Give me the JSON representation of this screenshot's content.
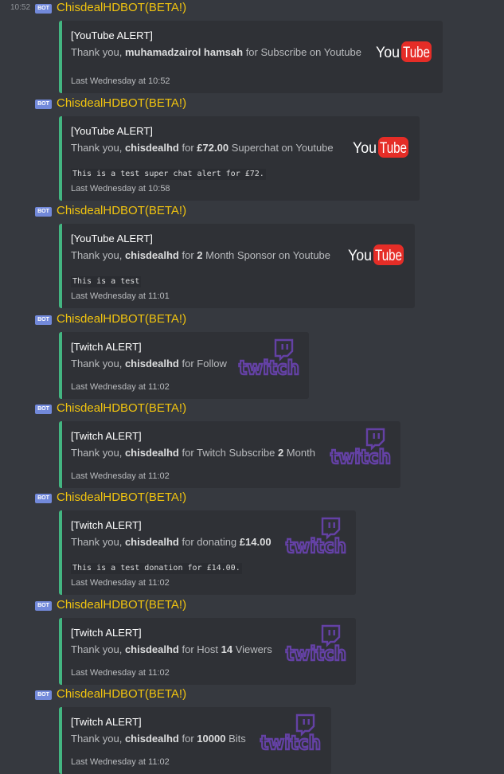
{
  "channel": {
    "first_timestamp": "10:52",
    "bot_tag": "BOT",
    "author": "ChisdealHDBOT(BETA!)"
  },
  "colors": {
    "background": "#36393f",
    "embed_background": "#2f3136",
    "embed_border": "#43b581",
    "author": "#f1c40f",
    "bot_tag": "#7289da",
    "youtube_red": "#e52d27",
    "twitch_purple": "#6441a5"
  },
  "messages": [
    {
      "title": "[YouTube ALERT]",
      "thank": "Thank you,",
      "user": "muhamadzairol hamsah",
      "pre": "for",
      "amount": "",
      "rest": "Subscribe on Youtube",
      "code": "",
      "footer": "Last Wednesday at 10:52",
      "logo": "youtube-logo",
      "logo_you": "You",
      "logo_tube": "Tube"
    },
    {
      "title": "[YouTube ALERT]",
      "thank": "Thank you,",
      "user": "chisdealhd",
      "pre": "for",
      "amount": "£72.00",
      "rest": "Superchat on Youtube",
      "code": "This is a test super chat alert for £72.",
      "footer": "Last Wednesday at 10:58",
      "logo": "youtube-logo",
      "logo_you": "You",
      "logo_tube": "Tube"
    },
    {
      "title": "[YouTube ALERT]",
      "thank": "Thank you,",
      "user": "chisdealhd",
      "pre": "for",
      "amount": "2",
      "rest": "Month Sponsor on Youtube",
      "code": "This is a test",
      "footer": "Last Wednesday at 11:01",
      "logo": "youtube-logo",
      "logo_you": "You",
      "logo_tube": "Tube"
    },
    {
      "title": "[Twitch ALERT]",
      "thank": "Thank you,",
      "user": "chisdealhd",
      "pre": "for",
      "amount": "",
      "rest": "Follow",
      "code": "",
      "footer": "Last Wednesday at 11:02",
      "logo": "twitch-logo",
      "logo_text": "twitch"
    },
    {
      "title": "[Twitch ALERT]",
      "thank": "Thank you,",
      "user": "chisdealhd",
      "pre": "for Twitch Subscribe",
      "amount": "2",
      "rest": "Month",
      "code": "",
      "footer": "Last Wednesday at 11:02",
      "logo": "twitch-logo",
      "logo_text": "twitch"
    },
    {
      "title": "[Twitch ALERT]",
      "thank": "Thank you,",
      "user": "chisdealhd",
      "pre": "for donating",
      "amount": "£14.00",
      "rest": "",
      "code": "This is a test donation for £14.00.",
      "footer": "Last Wednesday at 11:02",
      "logo": "twitch-logo",
      "logo_text": "twitch"
    },
    {
      "title": "[Twitch ALERT]",
      "thank": "Thank you,",
      "user": "chisdealhd",
      "pre": "for Host",
      "amount": "14",
      "rest": "Viewers",
      "code": "",
      "footer": "Last Wednesday at 11:02",
      "logo": "twitch-logo",
      "logo_text": "twitch"
    },
    {
      "title": "[Twitch ALERT]",
      "thank": "Thank you,",
      "user": "chisdealhd",
      "pre": "for",
      "amount": "10000",
      "rest": "Bits",
      "code": "",
      "footer": "Last Wednesday at 11:02",
      "logo": "twitch-logo",
      "logo_text": "twitch"
    }
  ]
}
